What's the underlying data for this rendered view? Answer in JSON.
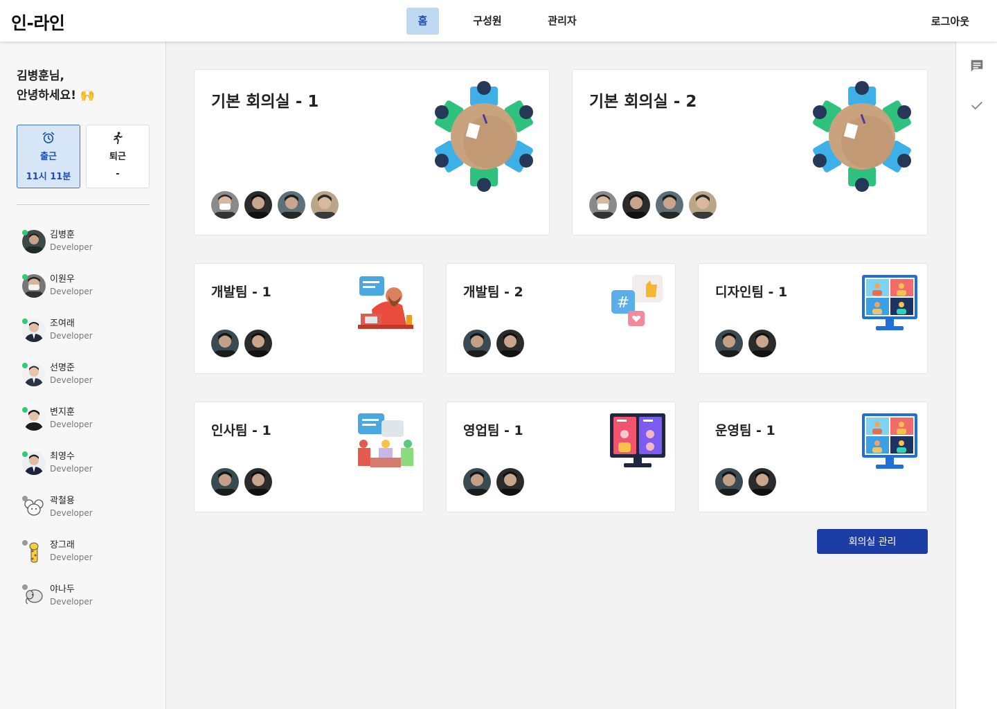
{
  "app": {
    "logo": "인-라인"
  },
  "nav": {
    "tabs": [
      {
        "label": "홈",
        "active": true
      },
      {
        "label": "구성원",
        "active": false
      },
      {
        "label": "관리자",
        "active": false
      }
    ],
    "logout": "로그아웃"
  },
  "sidebar": {
    "greeting_line1": "김병훈님,",
    "greeting_line2": "안녕하세요! 🙌",
    "clock_in": {
      "label": "출근",
      "time": "11시 11분",
      "icon": "alarm-clock-icon"
    },
    "clock_out": {
      "label": "퇴근",
      "time": "-",
      "icon": "running-person-icon"
    },
    "members": [
      {
        "name": "김병훈",
        "role": "Developer",
        "online": true,
        "avatar": "photo-dark"
      },
      {
        "name": "이원우",
        "role": "Developer",
        "online": true,
        "avatar": "photo-mask"
      },
      {
        "name": "조여래",
        "role": "Developer",
        "online": true,
        "avatar": "photo-suit"
      },
      {
        "name": "선명준",
        "role": "Developer",
        "online": true,
        "avatar": "photo-suit"
      },
      {
        "name": "변지훈",
        "role": "Developer",
        "online": true,
        "avatar": "photo-dark"
      },
      {
        "name": "최영수",
        "role": "Developer",
        "online": true,
        "avatar": "photo-suit"
      },
      {
        "name": "곽철용",
        "role": "Developer",
        "online": false,
        "avatar": "mouse-illustration"
      },
      {
        "name": "장그래",
        "role": "Developer",
        "online": false,
        "avatar": "giraffe-illustration"
      },
      {
        "name": "야나두",
        "role": "Developer",
        "online": false,
        "avatar": "elephant-illustration"
      }
    ]
  },
  "rooms": {
    "big": [
      {
        "title": "기본 회의실 - 1",
        "illustration": "round-table-icon",
        "participants": 4
      },
      {
        "title": "기본 회의실 - 2",
        "illustration": "round-table-icon",
        "participants": 4
      }
    ],
    "small": [
      {
        "title": "개발팀 - 1",
        "illustration": "thinking-person-icon",
        "participants": 2
      },
      {
        "title": "개발팀 - 2",
        "illustration": "social-chat-icon",
        "participants": 2
      },
      {
        "title": "디자인팀 - 1",
        "illustration": "video-call-monitor-icon",
        "participants": 2
      },
      {
        "title": "인사팀 - 1",
        "illustration": "meeting-group-icon",
        "participants": 2
      },
      {
        "title": "영업팀 - 1",
        "illustration": "video-call-monitor-dark-icon",
        "participants": 2
      },
      {
        "title": "운영팀 - 1",
        "illustration": "video-call-monitor-icon",
        "participants": 2
      }
    ]
  },
  "actions": {
    "manage_rooms": "회의실 관리"
  },
  "colors": {
    "accent": "#1c3da6",
    "active_tab_bg": "#bfd9f3",
    "online": "#2ecc71",
    "offline": "#999999"
  },
  "rightbar": {
    "icons": [
      "chat-icon",
      "check-icon"
    ]
  }
}
